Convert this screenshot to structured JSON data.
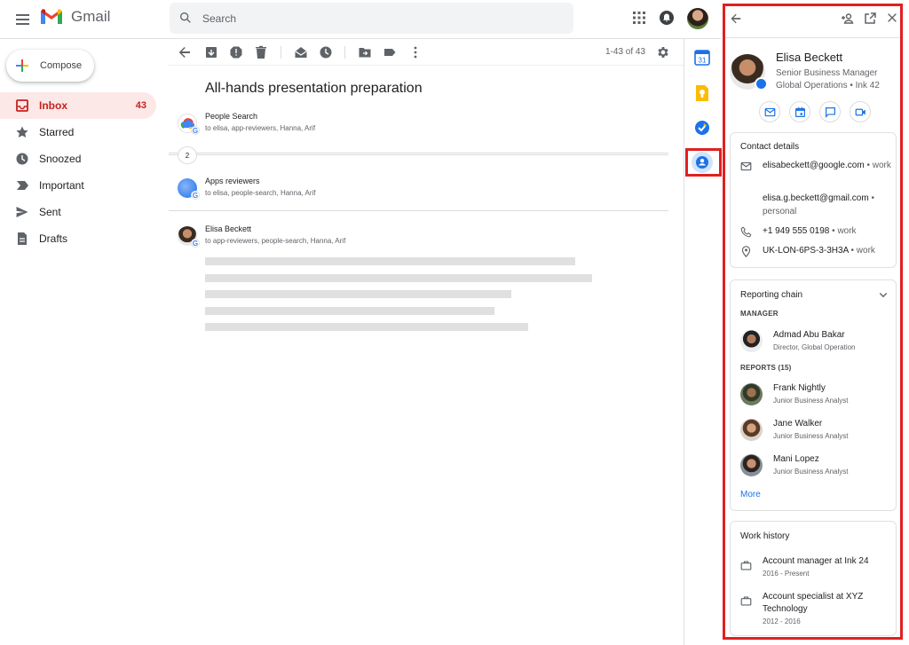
{
  "header": {
    "app_name": "Gmail",
    "search_placeholder": "Search"
  },
  "compose": {
    "label": "Compose"
  },
  "nav": {
    "items": [
      {
        "label": "Inbox",
        "count": "43",
        "icon": "inbox-icon"
      },
      {
        "label": "Starred",
        "icon": "star-icon"
      },
      {
        "label": "Snoozed",
        "icon": "clock-icon"
      },
      {
        "label": "Important",
        "icon": "important-icon"
      },
      {
        "label": "Sent",
        "icon": "send-icon"
      },
      {
        "label": "Drafts",
        "icon": "draft-icon"
      }
    ]
  },
  "toolbar": {
    "pager": "1-43 of 43"
  },
  "thread": {
    "subject": "All-hands presentation preparation",
    "collapsed_count": "2",
    "messages": [
      {
        "sender": "People Search",
        "to": "to elisa, app-reviewers, Hanna, Arif"
      },
      {
        "sender": "Apps reviewers",
        "to": "to elisa, people-search, Hanna, Arif"
      },
      {
        "sender": "Elisa Beckett",
        "to": "to app-reviewers, people-search, Hanna, Arif"
      }
    ]
  },
  "profile": {
    "name": "Elisa Beckett",
    "title": "Senior Business Manager",
    "org": "Global Operations • Ink 42"
  },
  "contact": {
    "title": "Contact details",
    "email1": "elisabeckett@google.com",
    "email1_type": "work",
    "email2": "elisa.g.beckett@gmail.com",
    "email2_type": "personal",
    "phone": "+1 949 555 0198",
    "phone_type": "work",
    "location": "UK-LON-6PS-3-3H3A",
    "location_type": "work"
  },
  "reporting": {
    "title": "Reporting chain",
    "manager_label": "MANAGER",
    "manager": {
      "name": "Admad Abu Bakar",
      "role": "Director, Global Operation"
    },
    "reports_label": "REPORTS (15)",
    "reports": [
      {
        "name": "Frank Nightly",
        "role": "Junior Business Analyst"
      },
      {
        "name": "Jane Walker",
        "role": "Junior Business Analyst"
      },
      {
        "name": "Mani Lopez",
        "role": "Junior Business Analyst"
      }
    ],
    "more": "More"
  },
  "work_history": {
    "title": "Work history",
    "items": [
      {
        "role": "Account manager at Ink 24",
        "dates": "2016 - Present"
      },
      {
        "role": "Account specialist at XYZ Technology",
        "dates": "2012 - 2016"
      }
    ]
  },
  "colors": {
    "highlight": "#e02020",
    "accent": "#1a73e8",
    "inbox_active": "#c5221f"
  }
}
